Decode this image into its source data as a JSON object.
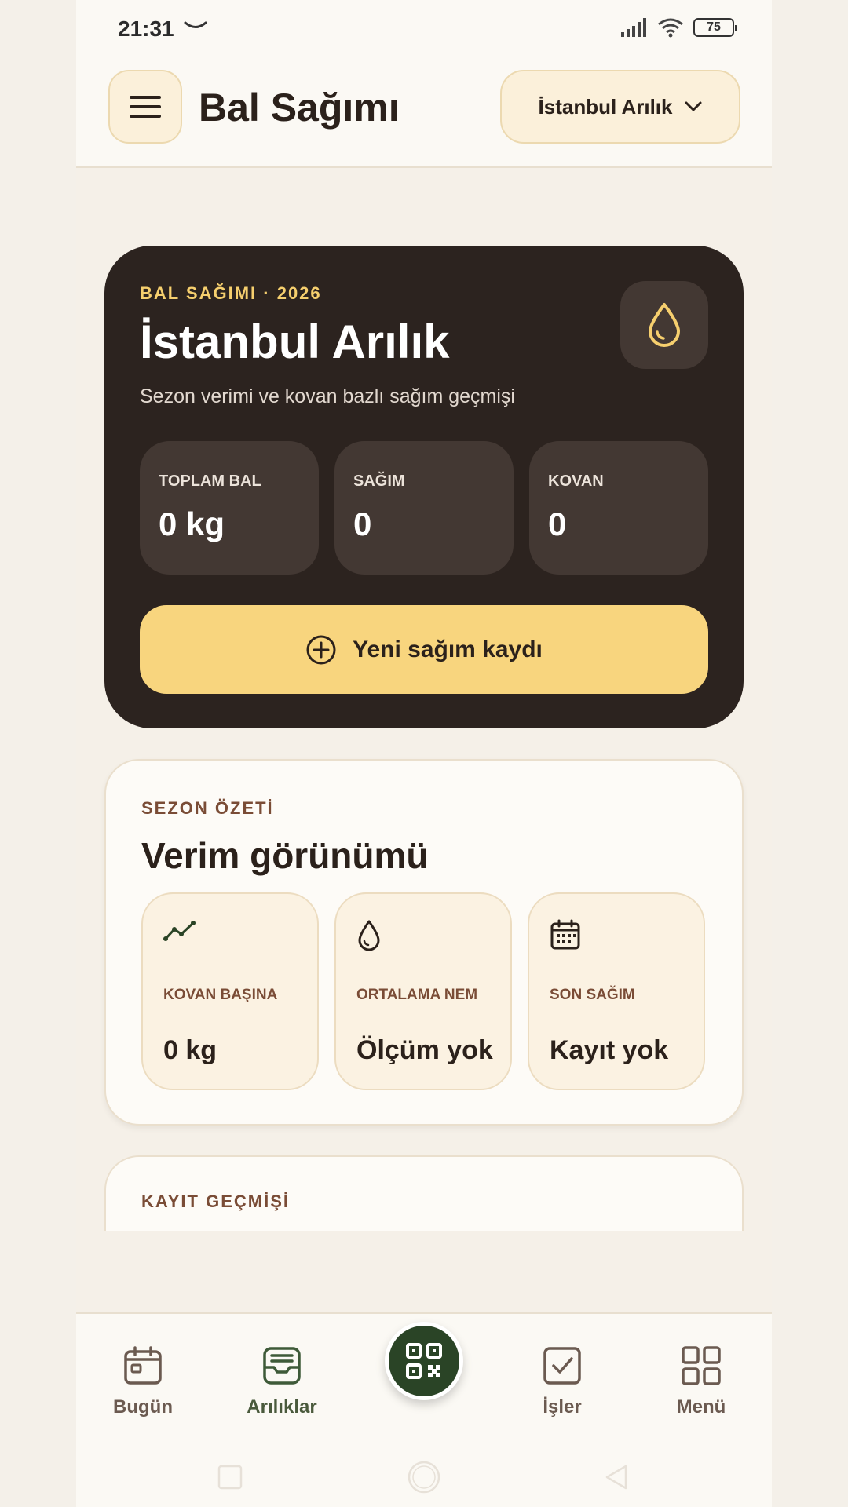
{
  "status_bar": {
    "time": "21:31",
    "battery": "75"
  },
  "header": {
    "title": "Bal Sağımı",
    "apiary_selector": "İstanbul Arılık"
  },
  "hero": {
    "kicker": "BAL SAĞIMI · 2026",
    "apiary_name": "İstanbul Arılık",
    "subtitle": "Sezon verimi ve kovan bazlı sağım geçmişi",
    "stats": [
      {
        "label": "TOPLAM BAL",
        "value": "0 kg"
      },
      {
        "label": "SAĞIM",
        "value": "0"
      },
      {
        "label": "KOVAN",
        "value": "0"
      }
    ],
    "cta_label": "Yeni sağım kaydı"
  },
  "summary": {
    "kicker": "SEZON ÖZETİ",
    "title": "Verim görünümü",
    "tiles": [
      {
        "icon": "trend-line-icon",
        "label": "KOVAN BAŞINA",
        "value": "0 kg"
      },
      {
        "icon": "drop-icon",
        "label": "ORTALAMA NEM",
        "value": "Ölçüm yok"
      },
      {
        "icon": "calendar-icon",
        "label": "SON SAĞIM",
        "value": "Kayıt yok"
      }
    ]
  },
  "history": {
    "kicker": "KAYIT GEÇMİŞİ"
  },
  "bottom_nav": {
    "items": [
      {
        "label": "Bugün",
        "icon": "calendar-icon"
      },
      {
        "label": "Arılıklar",
        "icon": "inbox-icon"
      },
      {
        "label": "İşler",
        "icon": "check-square-icon"
      },
      {
        "label": "Menü",
        "icon": "grid-icon"
      }
    ],
    "center_icon": "qr-code-icon"
  },
  "colors": {
    "hero_bg": "#2c231f",
    "accent_yellow": "#f8d57e",
    "kicker_brown": "#7a4c36",
    "nav_green": "#2a4426"
  }
}
